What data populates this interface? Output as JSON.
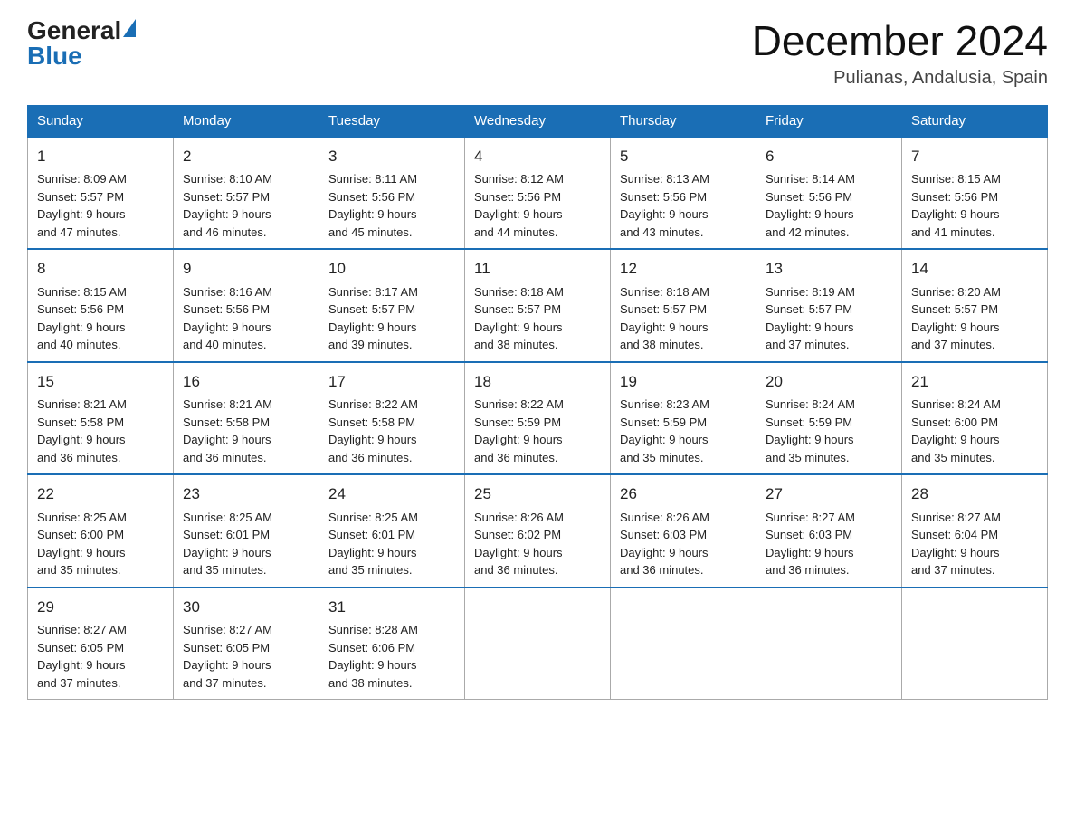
{
  "header": {
    "logo_general": "General",
    "logo_blue": "Blue",
    "month_title": "December 2024",
    "location": "Pulianas, Andalusia, Spain"
  },
  "weekdays": [
    "Sunday",
    "Monday",
    "Tuesday",
    "Wednesday",
    "Thursday",
    "Friday",
    "Saturday"
  ],
  "weeks": [
    [
      {
        "day": "1",
        "sunrise": "8:09 AM",
        "sunset": "5:57 PM",
        "daylight": "9 hours and 47 minutes."
      },
      {
        "day": "2",
        "sunrise": "8:10 AM",
        "sunset": "5:57 PM",
        "daylight": "9 hours and 46 minutes."
      },
      {
        "day": "3",
        "sunrise": "8:11 AM",
        "sunset": "5:56 PM",
        "daylight": "9 hours and 45 minutes."
      },
      {
        "day": "4",
        "sunrise": "8:12 AM",
        "sunset": "5:56 PM",
        "daylight": "9 hours and 44 minutes."
      },
      {
        "day": "5",
        "sunrise": "8:13 AM",
        "sunset": "5:56 PM",
        "daylight": "9 hours and 43 minutes."
      },
      {
        "day": "6",
        "sunrise": "8:14 AM",
        "sunset": "5:56 PM",
        "daylight": "9 hours and 42 minutes."
      },
      {
        "day": "7",
        "sunrise": "8:15 AM",
        "sunset": "5:56 PM",
        "daylight": "9 hours and 41 minutes."
      }
    ],
    [
      {
        "day": "8",
        "sunrise": "8:15 AM",
        "sunset": "5:56 PM",
        "daylight": "9 hours and 40 minutes."
      },
      {
        "day": "9",
        "sunrise": "8:16 AM",
        "sunset": "5:56 PM",
        "daylight": "9 hours and 40 minutes."
      },
      {
        "day": "10",
        "sunrise": "8:17 AM",
        "sunset": "5:57 PM",
        "daylight": "9 hours and 39 minutes."
      },
      {
        "day": "11",
        "sunrise": "8:18 AM",
        "sunset": "5:57 PM",
        "daylight": "9 hours and 38 minutes."
      },
      {
        "day": "12",
        "sunrise": "8:18 AM",
        "sunset": "5:57 PM",
        "daylight": "9 hours and 38 minutes."
      },
      {
        "day": "13",
        "sunrise": "8:19 AM",
        "sunset": "5:57 PM",
        "daylight": "9 hours and 37 minutes."
      },
      {
        "day": "14",
        "sunrise": "8:20 AM",
        "sunset": "5:57 PM",
        "daylight": "9 hours and 37 minutes."
      }
    ],
    [
      {
        "day": "15",
        "sunrise": "8:21 AM",
        "sunset": "5:58 PM",
        "daylight": "9 hours and 36 minutes."
      },
      {
        "day": "16",
        "sunrise": "8:21 AM",
        "sunset": "5:58 PM",
        "daylight": "9 hours and 36 minutes."
      },
      {
        "day": "17",
        "sunrise": "8:22 AM",
        "sunset": "5:58 PM",
        "daylight": "9 hours and 36 minutes."
      },
      {
        "day": "18",
        "sunrise": "8:22 AM",
        "sunset": "5:59 PM",
        "daylight": "9 hours and 36 minutes."
      },
      {
        "day": "19",
        "sunrise": "8:23 AM",
        "sunset": "5:59 PM",
        "daylight": "9 hours and 35 minutes."
      },
      {
        "day": "20",
        "sunrise": "8:24 AM",
        "sunset": "5:59 PM",
        "daylight": "9 hours and 35 minutes."
      },
      {
        "day": "21",
        "sunrise": "8:24 AM",
        "sunset": "6:00 PM",
        "daylight": "9 hours and 35 minutes."
      }
    ],
    [
      {
        "day": "22",
        "sunrise": "8:25 AM",
        "sunset": "6:00 PM",
        "daylight": "9 hours and 35 minutes."
      },
      {
        "day": "23",
        "sunrise": "8:25 AM",
        "sunset": "6:01 PM",
        "daylight": "9 hours and 35 minutes."
      },
      {
        "day": "24",
        "sunrise": "8:25 AM",
        "sunset": "6:01 PM",
        "daylight": "9 hours and 35 minutes."
      },
      {
        "day": "25",
        "sunrise": "8:26 AM",
        "sunset": "6:02 PM",
        "daylight": "9 hours and 36 minutes."
      },
      {
        "day": "26",
        "sunrise": "8:26 AM",
        "sunset": "6:03 PM",
        "daylight": "9 hours and 36 minutes."
      },
      {
        "day": "27",
        "sunrise": "8:27 AM",
        "sunset": "6:03 PM",
        "daylight": "9 hours and 36 minutes."
      },
      {
        "day": "28",
        "sunrise": "8:27 AM",
        "sunset": "6:04 PM",
        "daylight": "9 hours and 37 minutes."
      }
    ],
    [
      {
        "day": "29",
        "sunrise": "8:27 AM",
        "sunset": "6:05 PM",
        "daylight": "9 hours and 37 minutes."
      },
      {
        "day": "30",
        "sunrise": "8:27 AM",
        "sunset": "6:05 PM",
        "daylight": "9 hours and 37 minutes."
      },
      {
        "day": "31",
        "sunrise": "8:28 AM",
        "sunset": "6:06 PM",
        "daylight": "9 hours and 38 minutes."
      },
      null,
      null,
      null,
      null
    ]
  ]
}
